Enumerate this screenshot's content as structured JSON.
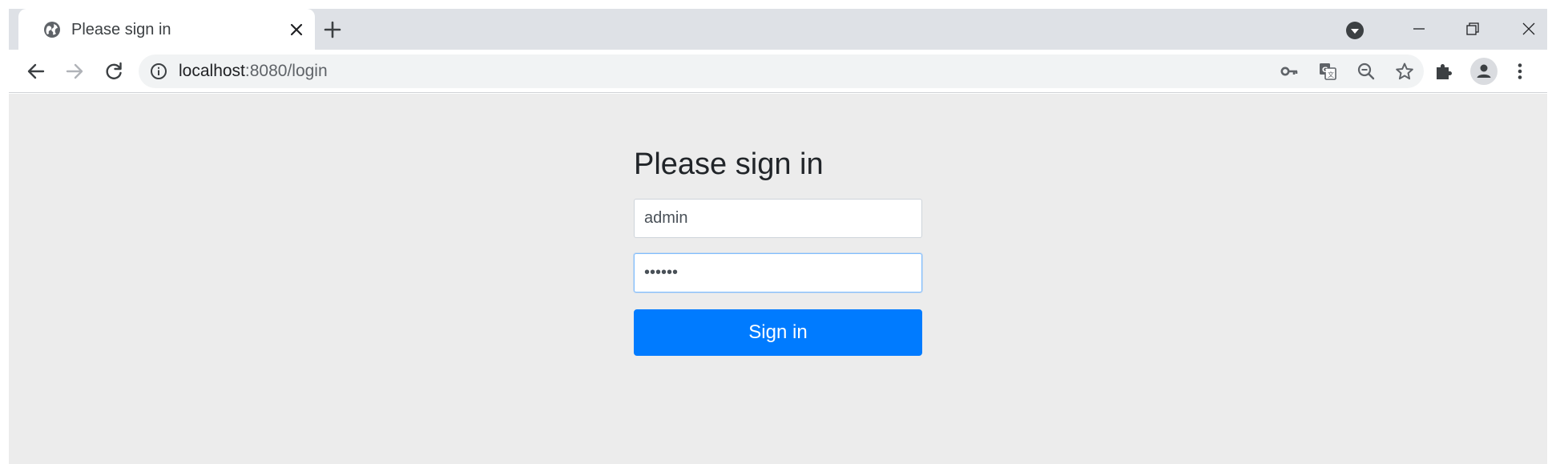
{
  "tab": {
    "title": "Please sign in",
    "favicon": "globe-icon",
    "close_icon": "close-icon"
  },
  "tabstrip": {
    "new_tab_icon": "plus-icon",
    "tab_search_icon": "chevron-down-circle-icon"
  },
  "window_controls": {
    "minimize_icon": "minimize-icon",
    "restore_icon": "restore-icon",
    "close_icon": "close-icon"
  },
  "toolbar": {
    "back_icon": "arrow-left-icon",
    "forward_icon": "arrow-right-icon",
    "reload_icon": "reload-icon",
    "site_info_icon": "info-icon",
    "url_host": "localhost",
    "url_rest": ":8080/login",
    "omnibox_icons": [
      "key-icon",
      "translate-icon",
      "zoom-out-icon",
      "star-icon"
    ],
    "extensions_icon": "puzzle-icon",
    "profile_icon": "person-icon",
    "menu_icon": "more-vertical-icon"
  },
  "page": {
    "heading": "Please sign in",
    "username_value": "admin",
    "password_value": "••••••",
    "signin_label": "Sign in"
  },
  "colors": {
    "primary_button": "#007bff",
    "page_background": "#ececec",
    "tabstrip_background": "#dee1e6",
    "focus_border": "#80bdff"
  }
}
